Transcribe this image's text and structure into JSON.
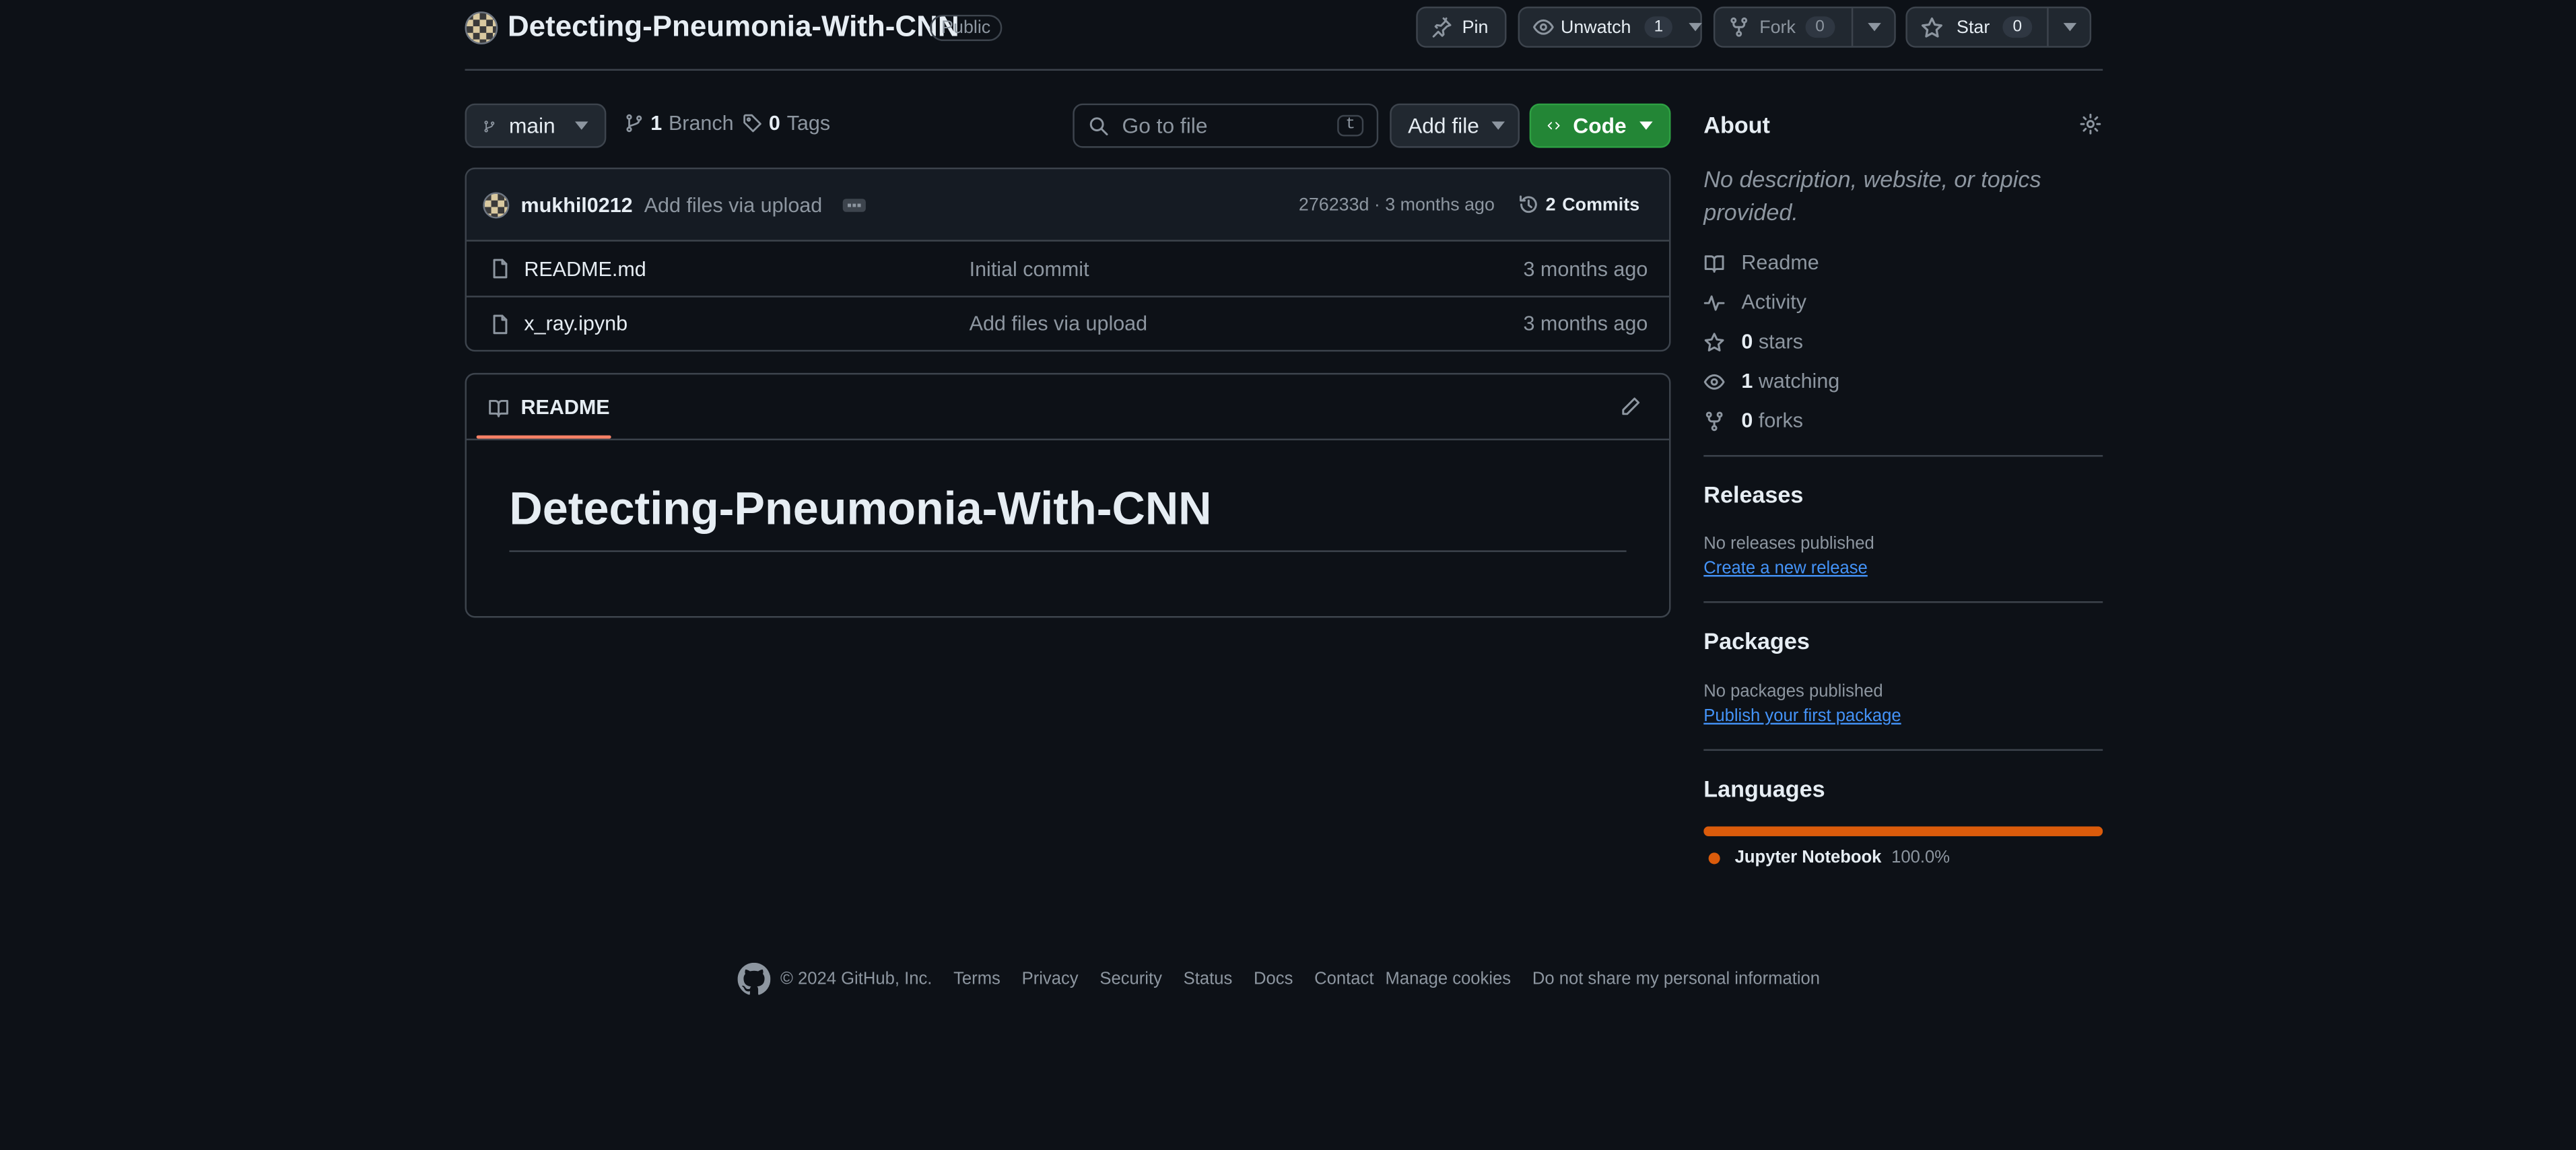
{
  "repo": {
    "name": "Detecting-Pneumonia-With-CNN",
    "visibility": "Public"
  },
  "header_actions": {
    "pin_label": "Pin",
    "unwatch_label": "Unwatch",
    "watch_count": "1",
    "fork_label": "Fork",
    "fork_count": "0",
    "star_label": "Star",
    "star_count": "0"
  },
  "toolbar": {
    "branch": "main",
    "branch_count": "1",
    "branch_label": "Branch",
    "tag_count": "0",
    "tag_label": "Tags",
    "search_placeholder": "Go to file",
    "search_shortcut": "t",
    "add_file_label": "Add file",
    "code_label": "Code"
  },
  "latest_commit": {
    "author": "mukhil0212",
    "message": "Add files via upload",
    "sha_time": "276233d · 3 months ago",
    "commits_count": "2",
    "commits_label": "Commits"
  },
  "files": [
    {
      "name": "README.md",
      "message": "Initial commit",
      "time": "3 months ago"
    },
    {
      "name": "x_ray.ipynb",
      "message": "Add files via upload",
      "time": "3 months ago"
    }
  ],
  "readme": {
    "tab_label": "README",
    "heading": "Detecting-Pneumonia-With-CNN"
  },
  "about": {
    "title": "About",
    "description": "No description, website, or topics provided.",
    "items": [
      {
        "icon": "book-icon",
        "count": "",
        "label": "Readme"
      },
      {
        "icon": "pulse-icon",
        "count": "",
        "label": "Activity"
      },
      {
        "icon": "star-icon",
        "count": "0",
        "label": "stars"
      },
      {
        "icon": "eye-icon",
        "count": "1",
        "label": "watching"
      },
      {
        "icon": "fork-icon",
        "count": "0",
        "label": "forks"
      }
    ]
  },
  "releases": {
    "title": "Releases",
    "empty_text": "No releases published",
    "link": "Create a new release"
  },
  "packages": {
    "title": "Packages",
    "empty_text": "No packages published",
    "link": "Publish your first package"
  },
  "languages": {
    "title": "Languages",
    "items": [
      {
        "name": "Jupyter Notebook",
        "percent": "100.0%",
        "fraction": 1.0,
        "color": "#DA5B0B"
      }
    ]
  },
  "footer": {
    "copyright": "© 2024 GitHub, Inc.",
    "links": [
      "Terms",
      "Privacy",
      "Security",
      "Status",
      "Docs",
      "Contact",
      "Manage cookies",
      "Do not share my personal information"
    ]
  },
  "colors": {
    "background": "#0d1117",
    "accent_green": "#238636",
    "link_blue": "#4493f8",
    "tab_underline": "#f78166"
  }
}
